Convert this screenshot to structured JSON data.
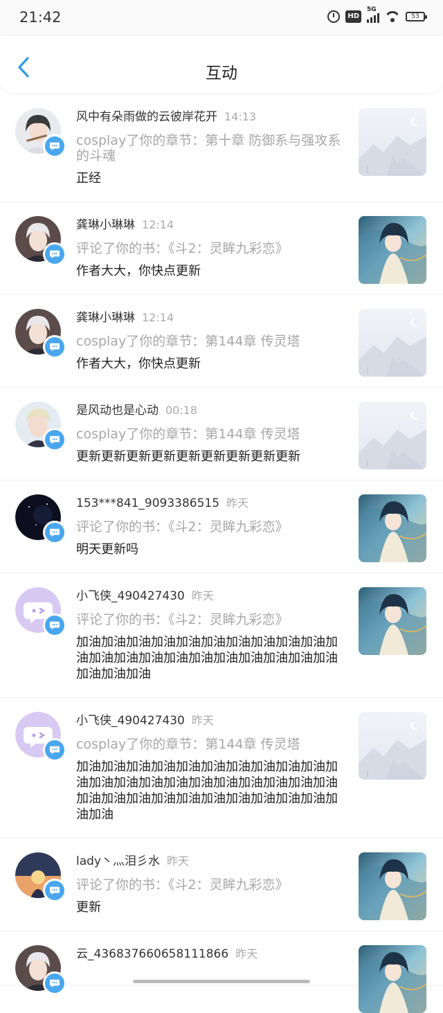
{
  "status_bar": {
    "time": "21:42",
    "network": "5G",
    "battery": "53",
    "hd": "HD"
  },
  "header": {
    "title": "互动"
  },
  "colors": {
    "accent": "#4aa7ee",
    "muted_text": "#a6a6a6"
  },
  "items": [
    {
      "name": "风中有朵雨做的云彼岸花开",
      "time": "14:13",
      "action": "cosplay了你的章节：第十章 防御系与强攻系的斗魂",
      "comment": "正经",
      "avatar": "girl-flute",
      "thumb": "placeholder"
    },
    {
      "name": "龚琳小琳琳",
      "time": "12:14",
      "action": "评论了你的书：《斗2：灵眸九彩恋》",
      "comment": "作者大大，你快点更新",
      "avatar": "boy-white-hair",
      "thumb": "cover"
    },
    {
      "name": "龚琳小琳琳",
      "time": "12:14",
      "action": "cosplay了你的章节：第144章 传灵塔",
      "comment": "作者大大，你快点更新",
      "avatar": "boy-white-hair",
      "thumb": "placeholder"
    },
    {
      "name": "是风动也是心动",
      "time": "00:18",
      "action": "cosplay了你的章节：第144章 传灵塔",
      "comment": "更新更新更新更新更新更新更新更新更新",
      "avatar": "boy-blond",
      "thumb": "placeholder"
    },
    {
      "name": "153***841_9093386515",
      "time": "昨天",
      "action": "评论了你的书：《斗2：灵眸九彩恋》",
      "comment": "明天更新吗",
      "avatar": "night-sky",
      "thumb": "cover"
    },
    {
      "name": "小飞侠_490427430",
      "time": "昨天",
      "action": "评论了你的书：《斗2：灵眸九彩恋》",
      "comment": "加油加油加油加油加油加油加油加油加油加油加油加油加油加油加油加油加油加油加油加油加油加油加油加油",
      "avatar": "default-chat",
      "thumb": "cover"
    },
    {
      "name": "小飞侠_490427430",
      "time": "昨天",
      "action": "cosplay了你的章节：第144章 传灵塔",
      "comment": "加油加油加油加油加油加油加油加油加油加油加油加油加油加油加油加油加油加油加油加油加油加油加油加油加油加油加油加油加油加油加油加油加油",
      "avatar": "default-chat",
      "thumb": "placeholder"
    },
    {
      "name": "lady丶灬泪彡水",
      "time": "昨天",
      "action": "评论了你的书：《斗2：灵眸九彩恋》",
      "comment": "更新",
      "avatar": "sunset-girl",
      "thumb": "cover"
    },
    {
      "name": "云_4368376606581118​66",
      "time": "昨天",
      "action": "",
      "comment": "",
      "avatar": "boy-white-hair",
      "thumb": "cover"
    }
  ]
}
